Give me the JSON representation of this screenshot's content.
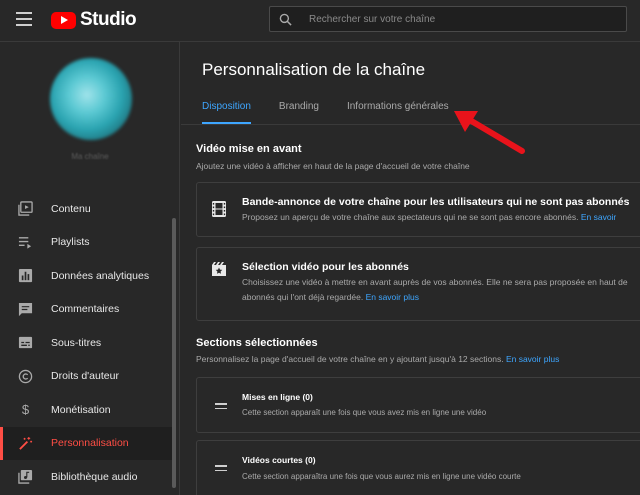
{
  "header": {
    "logo_text": "Studio",
    "search_placeholder": "Rechercher sur votre chaîne"
  },
  "sidebar": {
    "channel_name": "Ma chaîne",
    "items": [
      {
        "label": "Contenu",
        "icon": "video-library-icon"
      },
      {
        "label": "Playlists",
        "icon": "playlist-icon"
      },
      {
        "label": "Données analytiques",
        "icon": "analytics-icon"
      },
      {
        "label": "Commentaires",
        "icon": "comment-icon"
      },
      {
        "label": "Sous-titres",
        "icon": "subtitles-icon"
      },
      {
        "label": "Droits d'auteur",
        "icon": "copyright-icon"
      },
      {
        "label": "Monétisation",
        "icon": "dollar-icon"
      },
      {
        "label": "Personnalisation",
        "icon": "magic-wand-icon",
        "active": true
      },
      {
        "label": "Bibliothèque audio",
        "icon": "audio-library-icon"
      }
    ]
  },
  "main": {
    "title": "Personnalisation de la chaîne",
    "tabs": [
      {
        "label": "Disposition",
        "active": true
      },
      {
        "label": "Branding"
      },
      {
        "label": "Informations générales"
      }
    ],
    "featured": {
      "title": "Vidéo mise en avant",
      "desc": "Ajoutez une vidéo à afficher en haut de la page d'accueil de votre chaîne",
      "cards": [
        {
          "title": "Bande-annonce de votre chaîne pour les utilisateurs qui ne sont pas abonnés",
          "desc": "Proposez un aperçu de votre chaîne aux spectateurs qui ne se sont pas encore abonnés.",
          "link": "En savoir"
        },
        {
          "title": "Sélection vidéo pour les abonnés",
          "desc_line1": "Choisissez une vidéo à mettre en avant auprès de vos abonnés. Elle ne sera pas proposée en haut de",
          "desc_line2": "abonnés qui l'ont déjà regardée.",
          "link": "En savoir plus"
        }
      ]
    },
    "sections": {
      "title": "Sections sélectionnées",
      "desc": "Personnalisez la page d'accueil de votre chaîne en y ajoutant jusqu'à 12 sections.",
      "link": "En savoir plus",
      "items": [
        {
          "title": "Mises en ligne (0)",
          "desc": "Cette section apparaît une fois que vous avez mis en ligne une vidéo"
        },
        {
          "title": "Vidéos courtes (0)",
          "desc": "Cette section apparaîtra une fois que vous aurez mis en ligne une vidéo courte"
        }
      ]
    }
  },
  "colors": {
    "accent_blue": "#3ea6ff",
    "active_red": "#ff4e45",
    "annotation_arrow": "#e8131b"
  }
}
